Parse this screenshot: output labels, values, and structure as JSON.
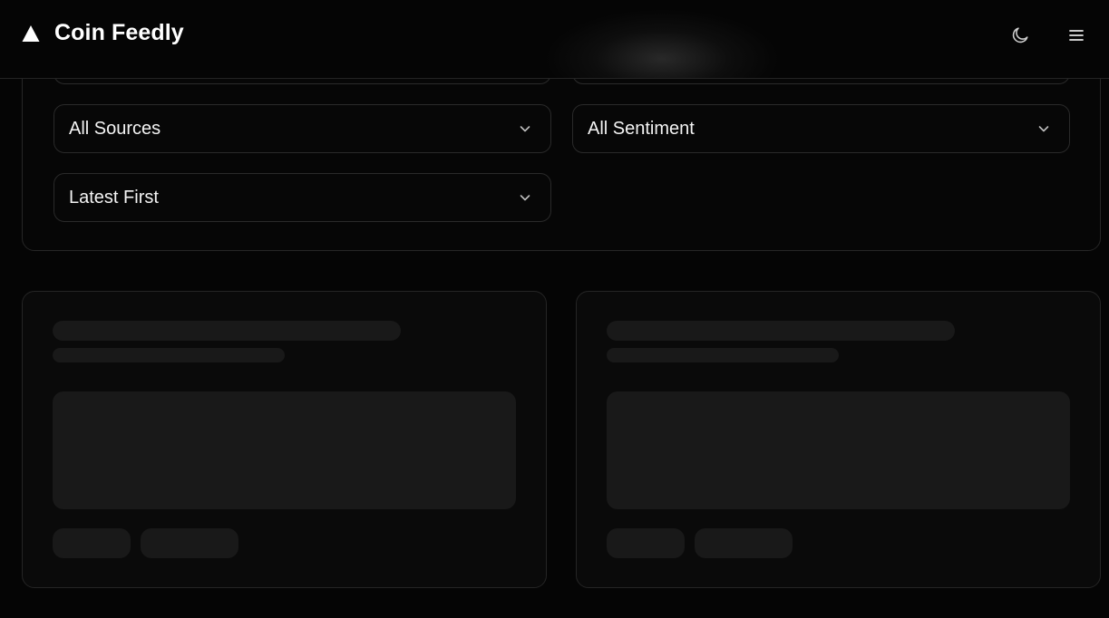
{
  "app": {
    "name": "Coin Feedly"
  },
  "header": {
    "logo_icon": "triangle-logo-icon",
    "theme_toggle_icon": "moon-icon",
    "menu_icon": "hamburger-menu-icon"
  },
  "filters": {
    "source_select": {
      "value": "All Sources",
      "icon": "chevron-down-icon"
    },
    "sentiment_select": {
      "value": "All Sentiment",
      "icon": "chevron-down-icon"
    },
    "sort_select": {
      "value": "Latest First",
      "icon": "chevron-down-icon"
    }
  },
  "cards": [
    {
      "state": "loading-skeleton"
    },
    {
      "state": "loading-skeleton"
    }
  ],
  "colors": {
    "background": "#050505",
    "border": "#262626",
    "skeleton": "#191919",
    "text": "#f4f4f4"
  }
}
